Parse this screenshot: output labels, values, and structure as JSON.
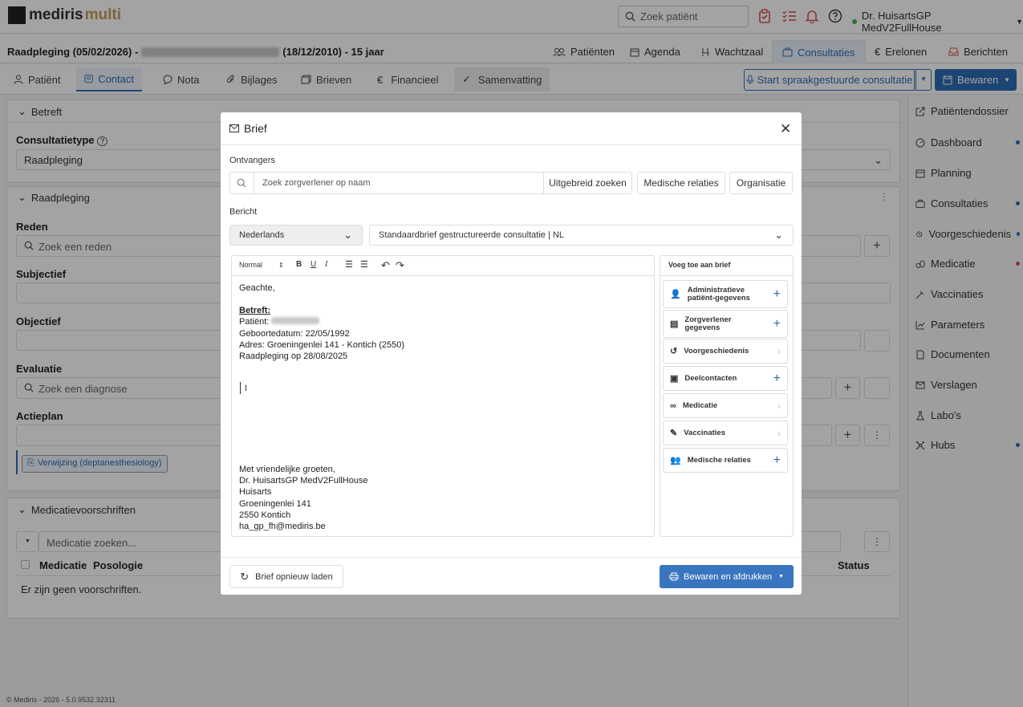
{
  "topbar": {
    "logo_a": "mediris",
    "logo_b": "multi",
    "search_placeholder": "Zoek patiënt",
    "user": "Dr. HuisartsGP MedV2FullHouse"
  },
  "header": {
    "title_prefix": "Raadpleging (05/02/2026) -",
    "title_suffix": "(18/12/2010) - 15 jaar"
  },
  "mainnav": [
    {
      "label": "Patiënten"
    },
    {
      "label": "Agenda"
    },
    {
      "label": "Wachtzaal"
    },
    {
      "label": "Consultaties"
    },
    {
      "label": "Erelonen"
    },
    {
      "label": "Berichten"
    }
  ],
  "tabs": [
    {
      "label": "Patiënt"
    },
    {
      "label": "Contact"
    },
    {
      "label": "Nota"
    },
    {
      "label": "Bijlages"
    },
    {
      "label": "Brieven"
    },
    {
      "label": "Financieel"
    },
    {
      "label": "Samenvatting"
    }
  ],
  "actions": {
    "speech": "Start spraakgestuurde consultatie",
    "save": "Bewaren"
  },
  "left": {
    "betreft": "Betreft",
    "consulttype_label": "Consultatietype",
    "consulttype_value": "Raadpleging",
    "raadpleging": "Raadpleging",
    "reden": "Reden",
    "reden_ph": "Zoek een reden",
    "subjectief": "Subjectief",
    "objectief": "Objectief",
    "evaluatie": "Evaluatie",
    "evaluatie_ph": "Zoek een diagnose",
    "actieplan": "Actieplan",
    "verwijzing": "Verwijzing (deptanesthesiology)",
    "medicatie_title": "Medicatievoorschriften",
    "medicatie_ph": "Medicatie zoeken...",
    "col_med": "Medicatie",
    "col_pos": "Posologie",
    "col_status": "Status",
    "empty": "Er zijn geen voorschriften."
  },
  "footer": "© Mediris - 2026 - 5.0.9532.32311",
  "sidebar": [
    {
      "label": "Patiëntendossier",
      "badge": ""
    },
    {
      "label": "Dashboard",
      "badge": "#2e6db4"
    },
    {
      "label": "Planning",
      "badge": ""
    },
    {
      "label": "Consultaties",
      "badge": "#2e6db4"
    },
    {
      "label": "Voorgeschiedenis",
      "badge": "#2e6db4"
    },
    {
      "label": "Medicatie",
      "badge": "#d9534f"
    },
    {
      "label": "Vaccinaties",
      "badge": ""
    },
    {
      "label": "Parameters",
      "badge": ""
    },
    {
      "label": "Documenten",
      "badge": ""
    },
    {
      "label": "Verslagen",
      "badge": ""
    },
    {
      "label": "Labo's",
      "badge": ""
    },
    {
      "label": "Hubs",
      "badge": "#2e6db4"
    }
  ],
  "modal": {
    "title": "Brief",
    "recipients_label": "Ontvangers",
    "recipients_ph": "Zoek zorgverlener op naam",
    "btn_ext": "Uitgebreid zoeken",
    "btn_med": "Medische relaties",
    "btn_org": "Organisatie",
    "message_label": "Bericht",
    "language": "Nederlands",
    "template": "Standaardbrief gestructureerde consultatie | NL",
    "format": "Normal",
    "letter": {
      "greeting": "Geachte,",
      "betreft": "Betreft:",
      "patient": "Patiënt:",
      "dob": "Geboortedatum: 22/05/1992",
      "address": "Adres: Groeningenlei 141 - Kontich (2550)",
      "consult": "Raadpleging op 28/08/2025",
      "closing": "Met vriendelijke groeten,",
      "sig1": "Dr. HuisartsGP MedV2FullHouse",
      "sig2": "Huisarts",
      "sig3": "Groeningenlei 141",
      "sig4": "2550 Kontich",
      "sig5": "ha_gp_fh@mediris.be"
    },
    "add_title": "Voeg toe aan brief",
    "add_items": [
      {
        "label": "Administratieve patiënt-gegevens"
      },
      {
        "label": "Zorgverlener gegevens"
      },
      {
        "label": "Voorgeschiedenis"
      },
      {
        "label": "Deelcontacten"
      },
      {
        "label": "Medicatie"
      },
      {
        "label": "Vaccinaties"
      },
      {
        "label": "Medische relaties"
      }
    ],
    "reload": "Brief opnieuw laden",
    "print": "Bewaren en afdrukken"
  }
}
